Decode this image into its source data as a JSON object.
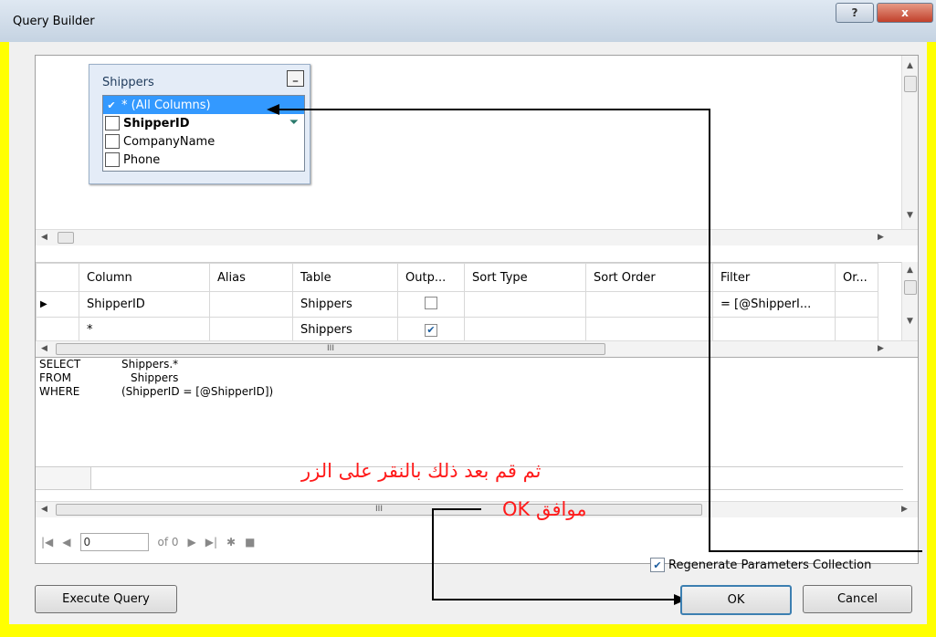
{
  "window": {
    "title": "Query Builder",
    "help_glyph": "?",
    "close_glyph": "x"
  },
  "diagram": {
    "table_name": "Shippers",
    "minimize_glyph": "_",
    "columns": [
      {
        "label": "* (All Columns)",
        "checked": true,
        "selected": true
      },
      {
        "label": "ShipperID",
        "checked": false,
        "bold": true,
        "filter_icon": "funnel-icon"
      },
      {
        "label": "CompanyName",
        "checked": false
      },
      {
        "label": "Phone",
        "checked": false
      }
    ]
  },
  "grid": {
    "headers": [
      "Column",
      "Alias",
      "Table",
      "Outp...",
      "Sort Type",
      "Sort Order",
      "Filter",
      "Or..."
    ],
    "rows": [
      {
        "indicator": "▶",
        "column": "ShipperID",
        "alias": "",
        "table": "Shippers",
        "output": false,
        "sort_type": "",
        "sort_order": "",
        "filter": "= [@ShipperI...",
        "or": ""
      },
      {
        "indicator": "",
        "column": "*",
        "alias": "",
        "table": "Shippers",
        "output": true,
        "sort_type": "",
        "sort_order": "",
        "filter": "",
        "or": ""
      }
    ],
    "hscroll_glyph": "III"
  },
  "sql": {
    "lines": [
      {
        "keyword": "SELECT",
        "expr": "Shippers.*"
      },
      {
        "keyword": "FROM",
        "expr": "Shippers"
      },
      {
        "keyword": "WHERE",
        "expr": "(ShipperID = [@ShipperID])"
      }
    ]
  },
  "results": {
    "hscroll_glyph": "III",
    "nav": {
      "record": "0",
      "of": "of 0"
    }
  },
  "annotation": {
    "line1": "ثم قم بعد ذلك بالنقر على الزر",
    "line2": "موافق OK",
    "color": "#ff1a1a"
  },
  "options": {
    "regenerate_label": "Regenerate Parameters Collection",
    "regenerate_checked": true
  },
  "buttons": {
    "execute": "Execute Query",
    "ok": "OK",
    "cancel": "Cancel"
  }
}
